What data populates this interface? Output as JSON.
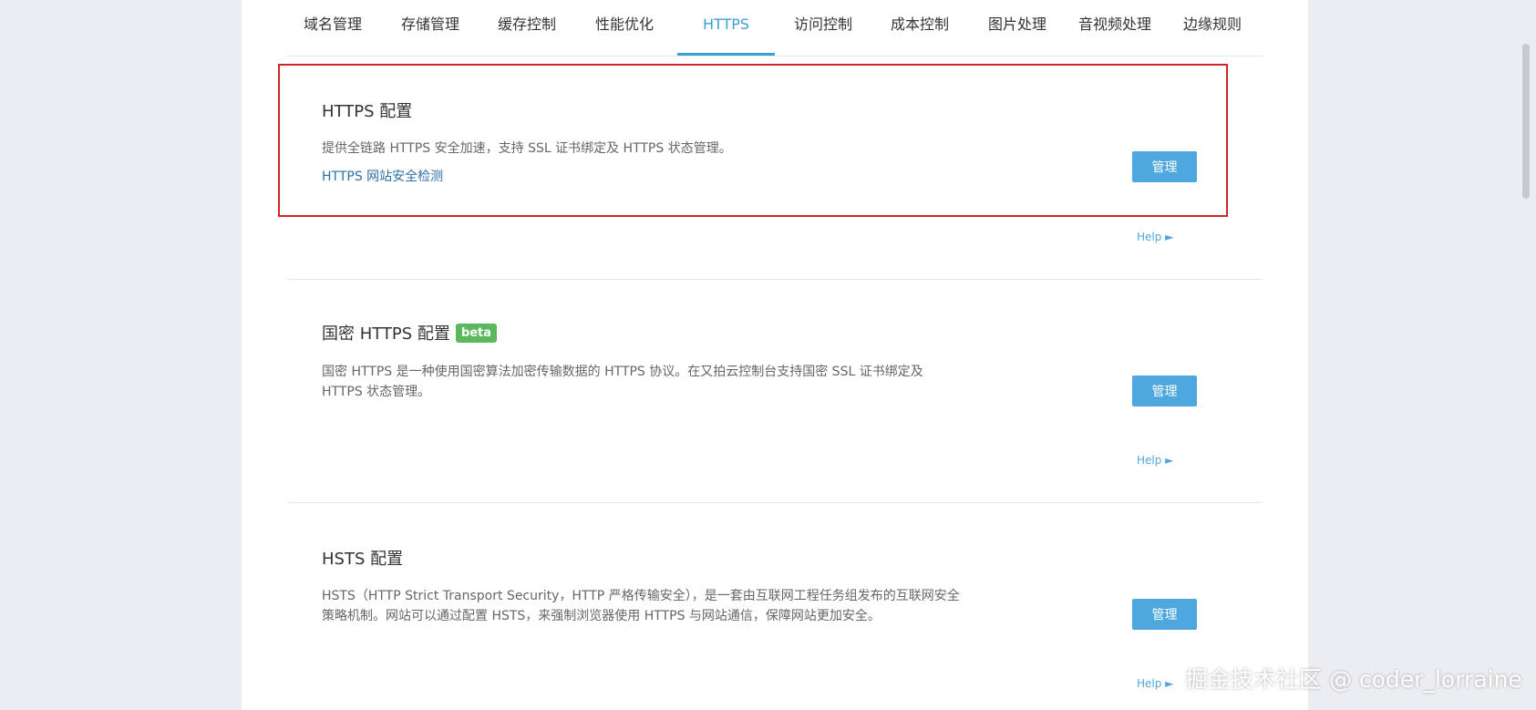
{
  "tabs": [
    {
      "label": "域名管理"
    },
    {
      "label": "存储管理"
    },
    {
      "label": "缓存控制"
    },
    {
      "label": "性能优化"
    },
    {
      "label": "HTTPS",
      "active": true
    },
    {
      "label": "访问控制"
    },
    {
      "label": "成本控制"
    },
    {
      "label": "图片处理"
    },
    {
      "label": "音视频处理"
    },
    {
      "label": "边缘规则"
    }
  ],
  "sections": [
    {
      "title": "HTTPS 配置",
      "desc": "提供全链路 HTTPS 安全加速，支持 SSL 证书绑定及 HTTPS 状态管理。",
      "link": "HTTPS 网站安全检测",
      "button": "管理",
      "help": "Help ►"
    },
    {
      "title": "国密 HTTPS 配置",
      "badge": "beta",
      "desc": "国密 HTTPS 是一种使用国密算法加密传输数据的 HTTPS 协议。在又拍云控制台支持国密 SSL 证书绑定及 HTTPS 状态管理。",
      "button": "管理",
      "help": "Help ►"
    },
    {
      "title": "HSTS 配置",
      "desc": "HSTS（HTTP Strict Transport Security，HTTP 严格传输安全），是一套由互联网工程任务组发布的互联网安全策略机制。网站可以通过配置 HSTS，来强制浏览器使用 HTTPS 与网站通信，保障网站更加安全。",
      "button": "管理",
      "help": "Help ►"
    }
  ],
  "watermark": "掘金技术社区 @ coder_lorraine",
  "colors": {
    "accent": "#4ea8dd",
    "active_tab": "#3d9fd6",
    "highlight_border": "#d2242a",
    "beta_badge": "#5cb85c"
  }
}
